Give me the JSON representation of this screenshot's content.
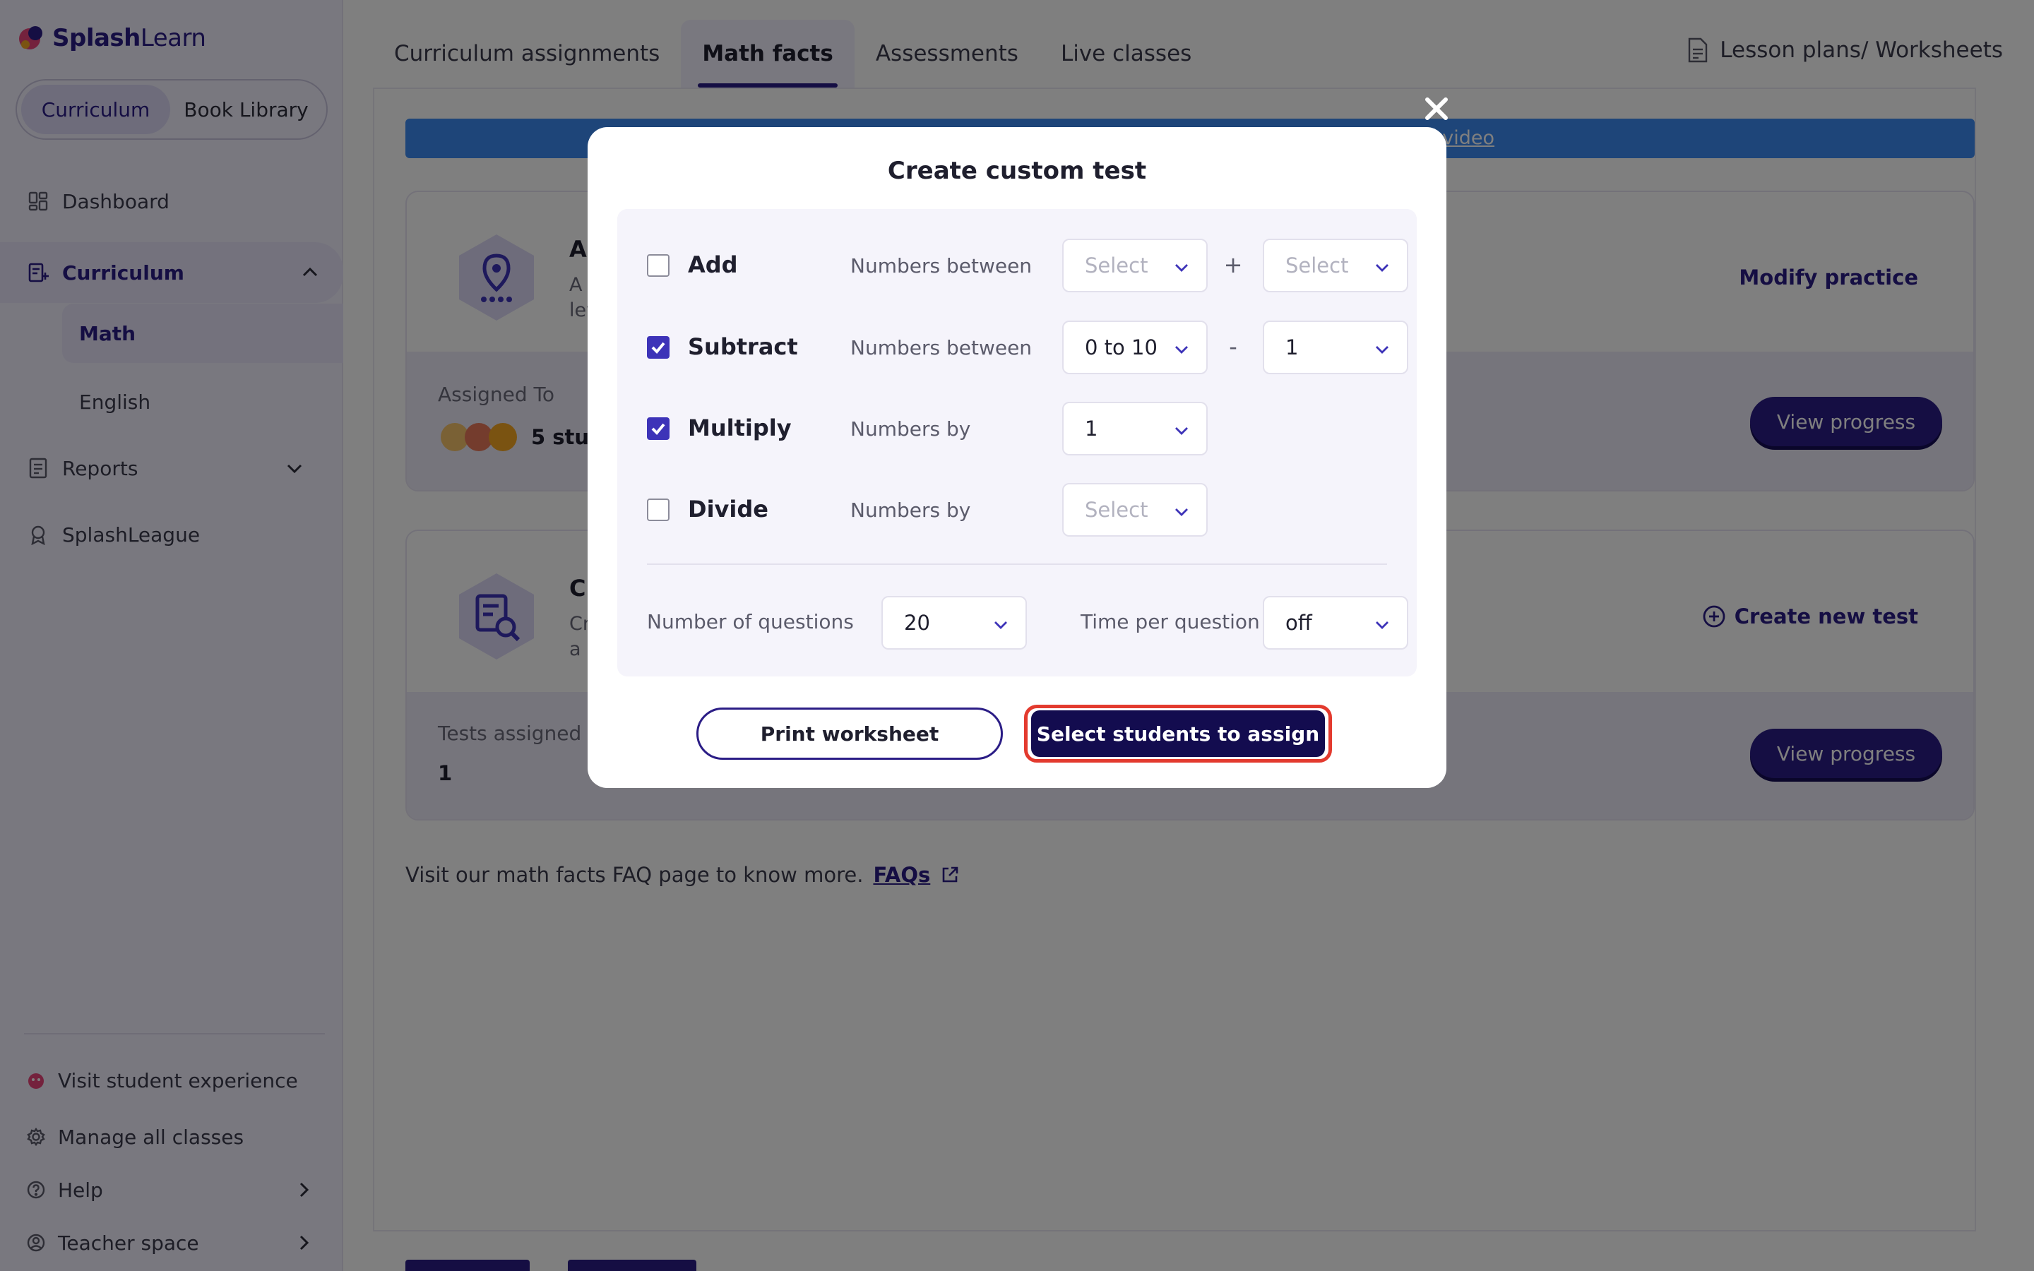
{
  "brand": {
    "name_bold": "Splash",
    "name_light": "Learn"
  },
  "sidebar": {
    "segments": [
      {
        "label": "Curriculum",
        "active": true
      },
      {
        "label": "Book Library",
        "active": false
      }
    ],
    "items": [
      {
        "label": "Dashboard",
        "icon": "dashboard-icon"
      },
      {
        "label": "Curriculum",
        "icon": "curriculum-icon",
        "expanded": true
      },
      {
        "label": "Math",
        "active": true
      },
      {
        "label": "English"
      },
      {
        "label": "Reports",
        "icon": "reports-icon",
        "expanded": false
      },
      {
        "label": "SplashLeague",
        "icon": "league-icon"
      }
    ],
    "bottom": [
      {
        "label": "Visit student experience",
        "icon": "student-icon"
      },
      {
        "label": "Manage all classes",
        "icon": "gear-icon"
      },
      {
        "label": "Help",
        "icon": "help-icon"
      },
      {
        "label": "Teacher space",
        "icon": "teacher-icon"
      }
    ]
  },
  "tabs": [
    {
      "label": "Curriculum assignments"
    },
    {
      "label": "Math facts",
      "active": true
    },
    {
      "label": "Assessments"
    },
    {
      "label": "Live classes"
    }
  ],
  "lesson_link": "Lesson plans/ Worksheets",
  "banner": {
    "link_text": "video"
  },
  "card1": {
    "title": "A",
    "desc_line1": "A",
    "desc_line2": "lev",
    "action": "Modify practice",
    "assigned_label": "Assigned To",
    "students": "5 stud",
    "button": "View progress"
  },
  "card2": {
    "title": "Cu",
    "desc_line1": "Cr",
    "desc_line2": "a s",
    "action": "Create new test",
    "tests_label": "Tests assigned",
    "tests_value": "1",
    "button": "View progress"
  },
  "faq": {
    "text": "Visit our math facts FAQ page to know more.",
    "link": "FAQs"
  },
  "modal": {
    "title": "Create custom test",
    "operations": [
      {
        "name": "Add",
        "checked": false,
        "sub": "Numbers between",
        "first": "Select",
        "sign": "+",
        "second": "Select"
      },
      {
        "name": "Subtract",
        "checked": true,
        "sub": "Numbers between",
        "first": "0 to 10",
        "sign": "-",
        "second": "1"
      },
      {
        "name": "Multiply",
        "checked": true,
        "sub": "Numbers by",
        "first": "1"
      },
      {
        "name": "Divide",
        "checked": false,
        "sub": "Numbers by",
        "first": "Select"
      }
    ],
    "num_questions_label": "Number of questions",
    "num_questions_value": "20",
    "time_label": "Time per question",
    "time_value": "off",
    "print_button": "Print worksheet",
    "assign_button": "Select students to assign"
  },
  "colors": {
    "brand": "#2b1d86",
    "banner": "#3d8bf2",
    "highlight": "#e33a2e",
    "checkbox": "#3d33b8"
  }
}
